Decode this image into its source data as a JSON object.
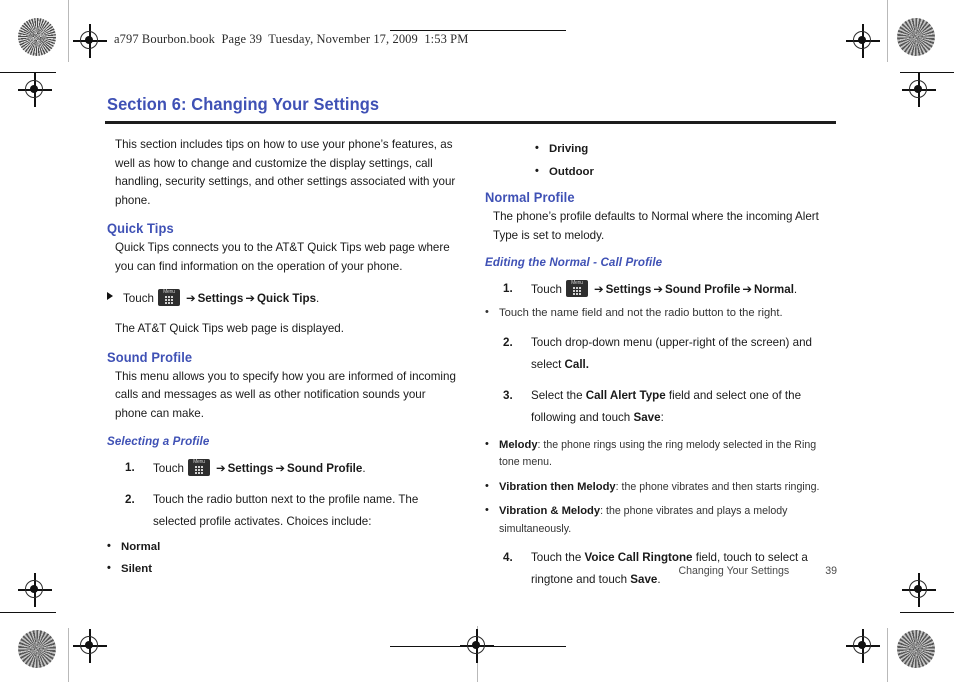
{
  "header": {
    "file_line": "a797 Bourbon.book  Page 39  Tuesday, November 17, 2009  1:53 PM"
  },
  "colors": {
    "heading_blue": "#3f51b5",
    "body_text": "#1a1a1a",
    "rule": "#1d1d1d",
    "menu_icon_bg": "#2e2e2e"
  },
  "section": {
    "title": "Section 6: Changing Your Settings"
  },
  "left_column": {
    "intro": "This section includes tips on how to use your phone’s features, as well as how to change and customize the display settings, call handling, security settings, and other settings associated with your phone.",
    "quick_tips": {
      "heading": "Quick Tips",
      "paragraph": "Quick Tips connects you to the AT&T Quick Tips web page where you can find information on the operation of your phone.",
      "step": {
        "touch_label": "Touch",
        "icon": "menu-hardkey-icon",
        "arrow": "➔",
        "target_1": "Settings",
        "target_2": "Quick Tips",
        "period": "."
      },
      "result": "The AT&T Quick Tips web page is displayed."
    },
    "sound_profile": {
      "heading": "Sound Profile",
      "paragraph": "This menu allows you to specify how you are informed of incoming calls and messages as well as other notification sounds your phone can make.",
      "selecting_a_profile": {
        "heading": "Selecting a Profile",
        "steps": [
          {
            "num": "1.",
            "touch_label": "Touch",
            "icon": "menu-hardkey-icon",
            "arrow": "➔",
            "target_1": "Settings",
            "target_2": "Sound Profile",
            "period": "."
          },
          {
            "num": "2.",
            "text": "Touch the radio button next to the profile name. The selected profile activates. Choices include:"
          }
        ],
        "choices": [
          "Normal",
          "Silent"
        ]
      }
    }
  },
  "right_column": {
    "choices_continued": [
      "Driving",
      "Outdoor"
    ],
    "normal_profile": {
      "heading": "Normal Profile",
      "paragraph": "The phone’s profile defaults to Normal where the incoming Alert Type is set to melody.",
      "editing": {
        "heading": "Editing the Normal - Call Profile",
        "step1": {
          "num": "1.",
          "touch_label": "Touch",
          "icon": "menu-hardkey-icon",
          "arrow": "➔",
          "target_1": "Settings",
          "target_2": "Sound Profile",
          "target_3": "Normal",
          "period": "."
        },
        "step1_note": "Touch the name field and not the radio button to the right.",
        "step2": {
          "num": "2.",
          "text_a": "Touch drop-down menu (upper-right of the screen) and select ",
          "bold_b": "Call",
          "text_c": "."
        },
        "step3": {
          "num": "3.",
          "text_a": "Select the ",
          "bold_b": "Call Alert Type",
          "text_c": " field and select one of the following and touch ",
          "bold_d": "Save",
          "text_e": ":"
        },
        "alert_types": [
          {
            "name": "Melody",
            "desc": ": the phone rings using the ring melody selected in the Ring tone menu."
          },
          {
            "name": "Vibration then Melody",
            "desc": ": the phone vibrates and then starts ringing."
          },
          {
            "name": "Vibration & Melody",
            "desc": ": the phone vibrates and plays a melody simultaneously."
          }
        ],
        "step4": {
          "num": "4.",
          "text_a": "Touch the ",
          "bold_b": "Voice Call Ringtone",
          "text_c": " field, touch to select a ringtone and touch ",
          "bold_d": "Save",
          "text_e": "."
        }
      }
    }
  },
  "footer": {
    "title": "Changing Your Settings",
    "page_number": "39"
  }
}
